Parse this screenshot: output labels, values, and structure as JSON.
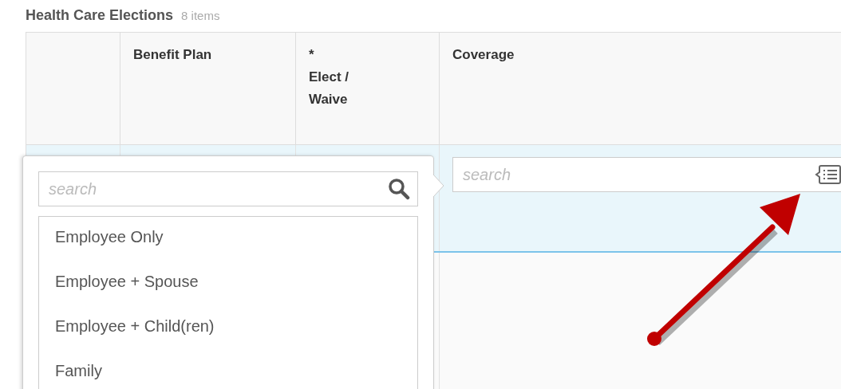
{
  "section": {
    "title": "Health Care Elections",
    "count": "8 items"
  },
  "table": {
    "columns": [
      {
        "label": "Benefit Plan"
      },
      {
        "marker": "*",
        "label": "Elect / Waive"
      },
      {
        "label": "Coverage"
      }
    ],
    "rows": [
      {
        "selected": true,
        "coverage_field": {
          "placeholder": "search"
        }
      },
      {
        "selected": false
      }
    ]
  },
  "dropdown": {
    "search": {
      "placeholder": "search"
    },
    "options": [
      "Employee Only",
      "Employee + Spouse",
      "Employee + Child(ren)",
      "Family"
    ]
  }
}
